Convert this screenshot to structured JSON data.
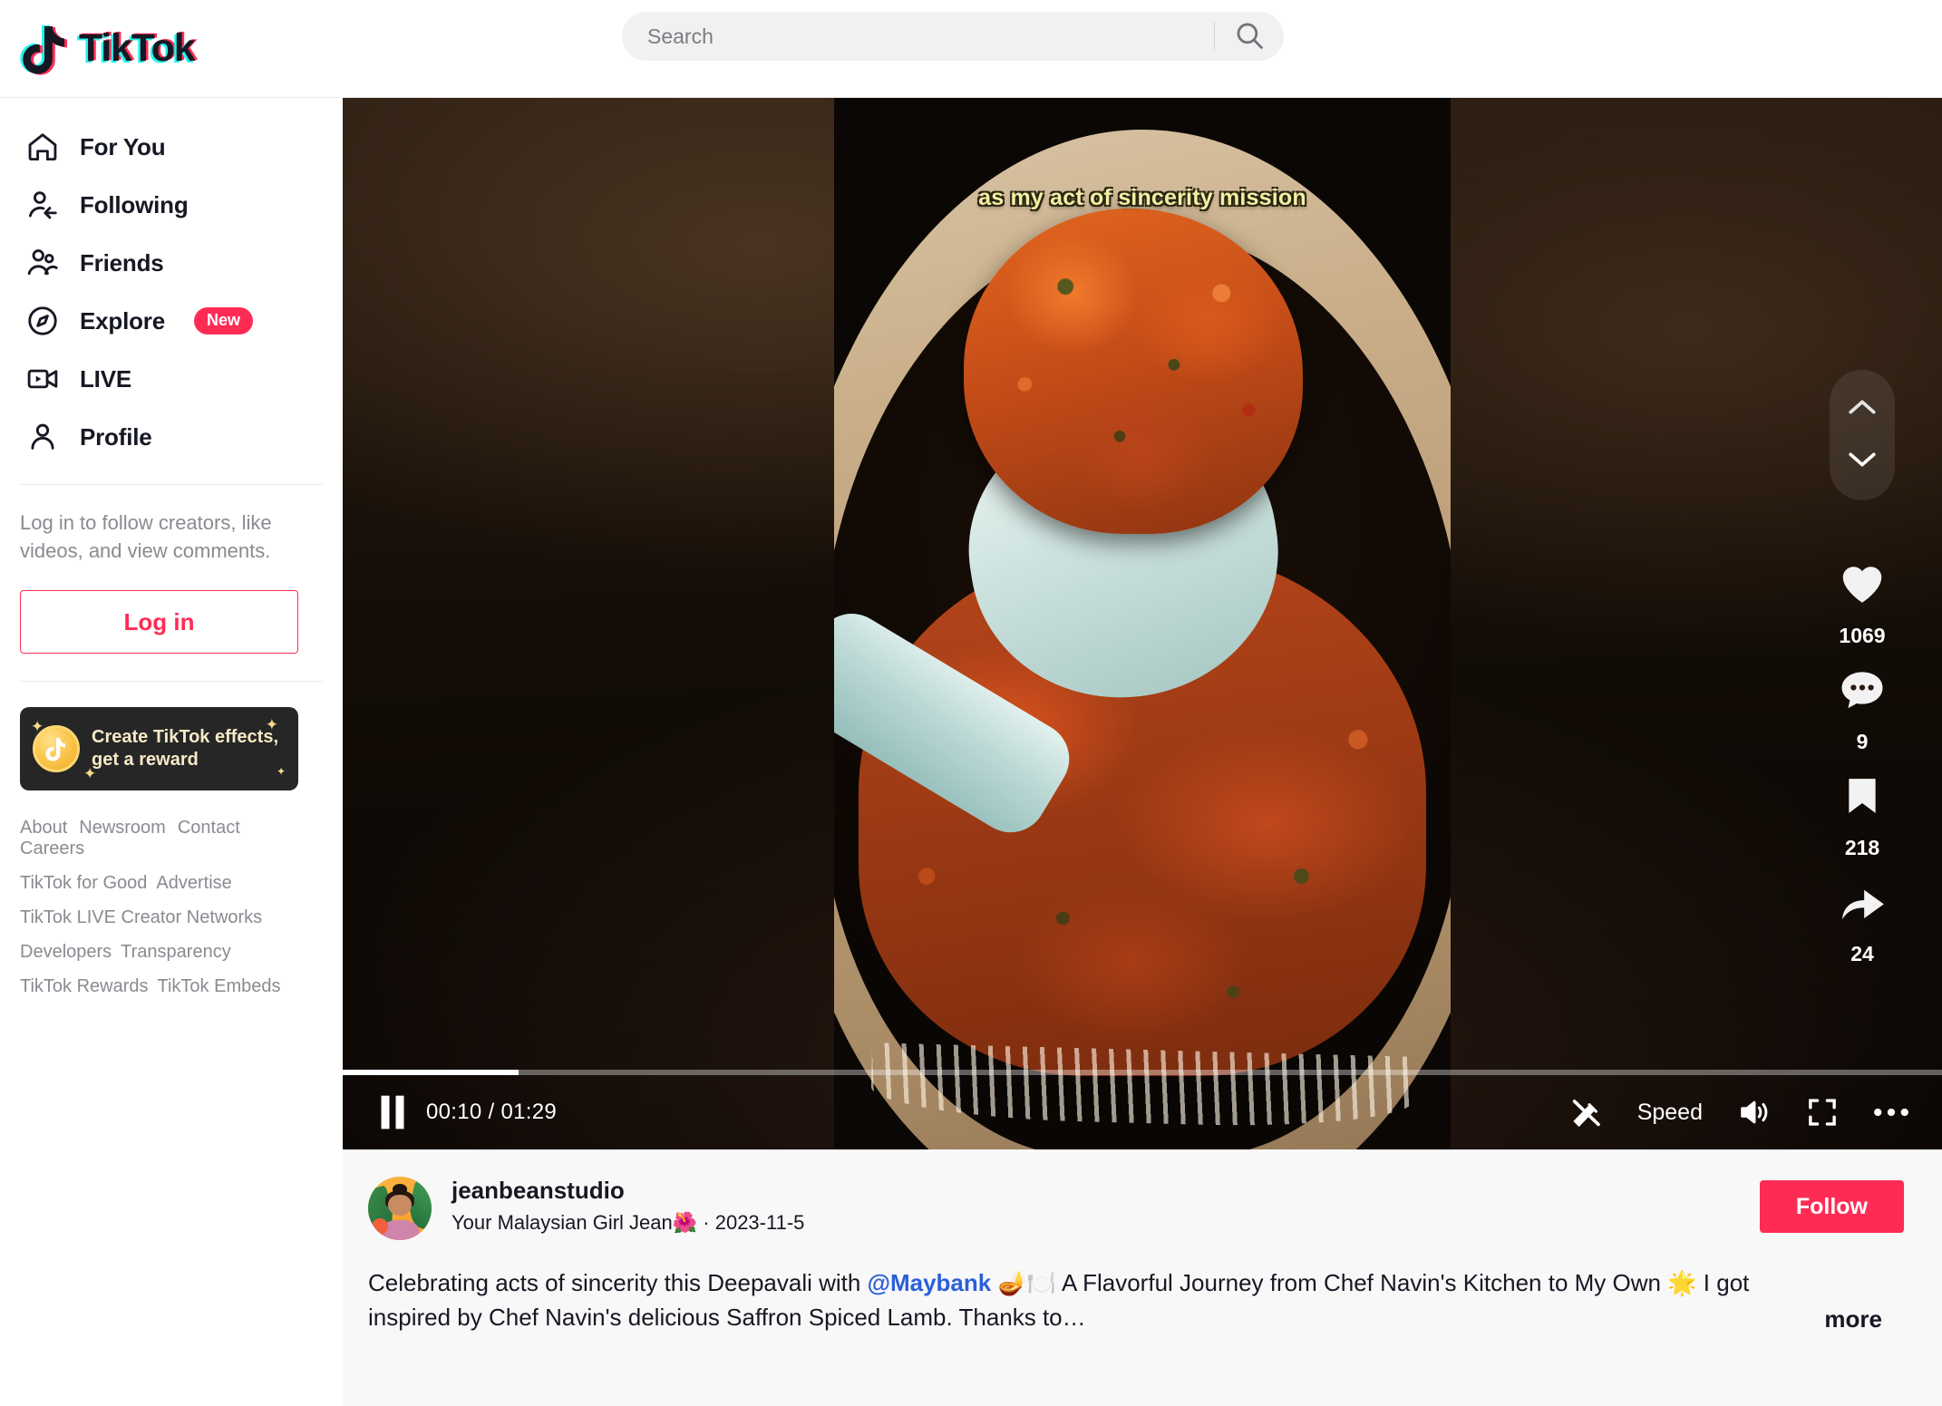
{
  "brand": {
    "name": "TikTok",
    "accent": "#fe2c55",
    "cyan": "#25f4ee"
  },
  "search": {
    "placeholder": "Search",
    "value": ""
  },
  "sidebar": {
    "items": [
      {
        "label": "For You",
        "icon": "home-icon"
      },
      {
        "label": "Following",
        "icon": "following-person-icon"
      },
      {
        "label": "Friends",
        "icon": "friends-icon"
      },
      {
        "label": "Explore",
        "icon": "compass-icon",
        "badge": "New"
      },
      {
        "label": "LIVE",
        "icon": "live-video-icon"
      },
      {
        "label": "Profile",
        "icon": "person-icon"
      }
    ],
    "login_prompt": "Log in to follow creators, like videos, and view comments.",
    "login_label": "Log in",
    "promo": {
      "line1": "Create TikTok effects,",
      "line2": "get a reward",
      "icon": "gold-coin-icon"
    },
    "footer": {
      "row1": [
        "About",
        "Newsroom",
        "Contact",
        "Careers"
      ],
      "row2": [
        "TikTok for Good",
        "Advertise"
      ],
      "row3": [
        "TikTok LIVE Creator Networks"
      ],
      "row4": [
        "Developers",
        "Transparency"
      ],
      "row5": [
        "TikTok Rewards",
        "TikTok Embeds"
      ]
    }
  },
  "video": {
    "subtitle": "as my act of sincerity mission",
    "current_time": "00:10",
    "duration": "01:29",
    "progress_percent": 11,
    "speed_label": "Speed",
    "playing": true,
    "actions": [
      {
        "name": "like",
        "icon": "heart-icon",
        "count": "1069"
      },
      {
        "name": "comment",
        "icon": "comment-icon",
        "count": "9"
      },
      {
        "name": "bookmark",
        "icon": "bookmark-icon",
        "count": "218"
      },
      {
        "name": "share",
        "icon": "share-arrow-icon",
        "count": "24"
      }
    ]
  },
  "post": {
    "username": "jeanbeanstudio",
    "nickname": "Your Malaysian Girl Jean🌺",
    "separator": " · ",
    "date": "2023-11-5",
    "follow_label": "Follow",
    "caption_part1": "Celebrating acts of sincerity this Deepavali with ",
    "mention": "@Maybank",
    "caption_part2": " 🪔🍽️ A Flavorful Journey from Chef Navin's Kitchen to My Own 🌟 I got inspired by Chef Navin's delicious Saffron Spiced Lamb. Thanks to…",
    "more_label": "more"
  }
}
